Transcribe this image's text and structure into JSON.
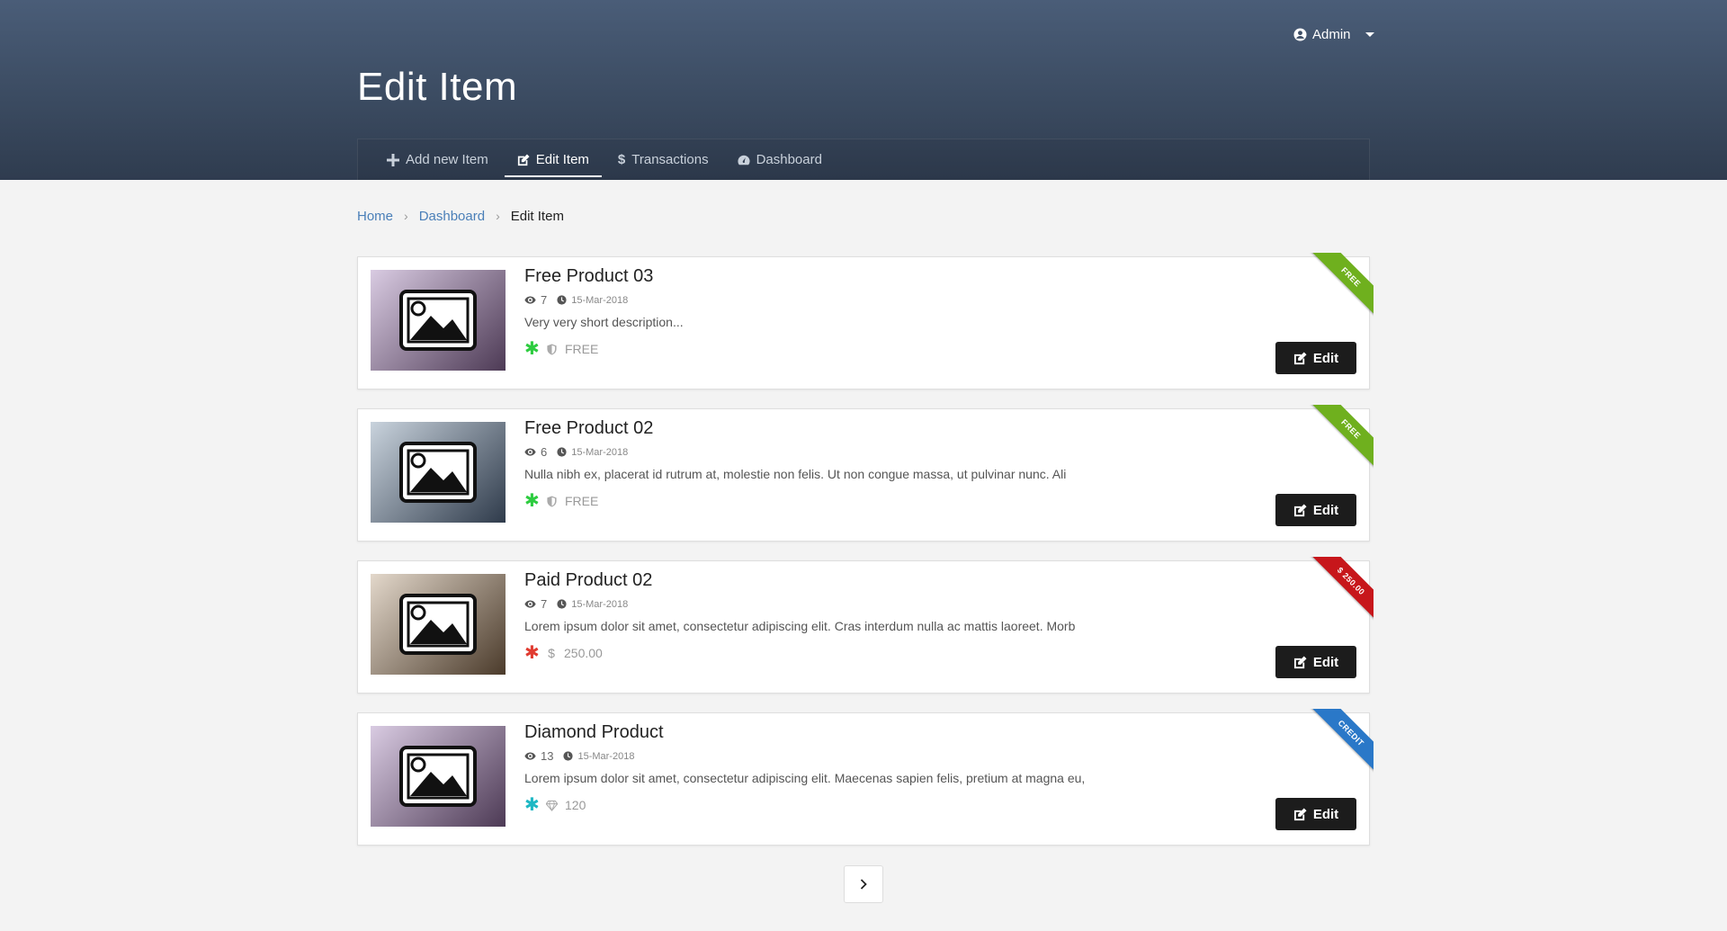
{
  "header": {
    "user_label": "Admin",
    "page_title": "Edit Item"
  },
  "tabs": [
    {
      "label": "Add new Item",
      "icon": "plus-icon"
    },
    {
      "label": "Edit Item",
      "icon": "edit-icon",
      "active": true
    },
    {
      "label": "Transactions",
      "icon": "dollar-icon"
    },
    {
      "label": "Dashboard",
      "icon": "dashboard-icon"
    }
  ],
  "breadcrumb": {
    "home": "Home",
    "dashboard": "Dashboard",
    "current": "Edit Item"
  },
  "items": [
    {
      "title": "Free Product 03",
      "views": "7",
      "date": "15-Mar-2018",
      "description": "Very very short description...",
      "price_icon": "shield-icon",
      "price": "FREE",
      "star_color": "#2ecc40",
      "ribbon": "FREE",
      "ribbon_color": "#6fb01e",
      "thumb_colors": [
        "#d9cbe2",
        "#4d3a55"
      ],
      "edit_label": "Edit"
    },
    {
      "title": "Free Product 02",
      "views": "6",
      "date": "15-Mar-2018",
      "description": "Nulla nibh ex, placerat id rutrum at, molestie non felis. Ut non congue massa, ut pulvinar nunc. Ali",
      "price_icon": "shield-icon",
      "price": "FREE",
      "star_color": "#2ecc40",
      "ribbon": "FREE",
      "ribbon_color": "#6fb01e",
      "thumb_colors": [
        "#c9d3dd",
        "#2f3b4b"
      ],
      "edit_label": "Edit"
    },
    {
      "title": "Paid Product 02",
      "views": "7",
      "date": "15-Mar-2018",
      "description": "Lorem ipsum dolor sit amet, consectetur adipiscing elit. Cras interdum nulla ac mattis laoreet. Morb",
      "price_icon": "dollar-icon",
      "price": "250.00",
      "star_color": "#e03c31",
      "ribbon": "$ 250.00",
      "ribbon_color": "#c7161b",
      "thumb_colors": [
        "#e3d8cb",
        "#4b3b2b"
      ],
      "edit_label": "Edit"
    },
    {
      "title": "Diamond Product",
      "views": "13",
      "date": "15-Mar-2018",
      "description": "Lorem ipsum dolor sit amet, consectetur adipiscing elit. Maecenas sapien felis, pretium at magna eu,",
      "price_icon": "diamond-icon",
      "price": "120",
      "star_color": "#1fb8c4",
      "ribbon": "CREDIT",
      "ribbon_color": "#2a78c8",
      "thumb_colors": [
        "#d9cbe2",
        "#4d3a55"
      ],
      "edit_label": "Edit"
    }
  ],
  "pagination": {
    "next_icon": "chevron-right-icon"
  }
}
